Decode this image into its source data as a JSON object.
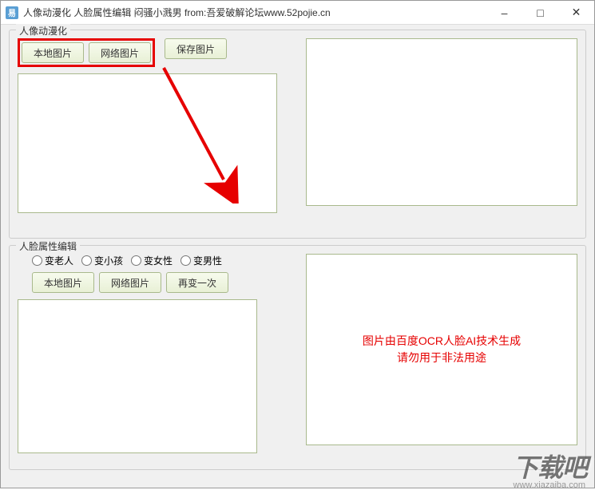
{
  "window": {
    "icon_text": "易",
    "title": "人像动漫化 人脸属性编辑 闷骚小溅男 from:吾爱破解论坛www.52pojie.cn"
  },
  "group1": {
    "title": "人像动漫化",
    "btn_local": "本地图片",
    "btn_net": "网络图片",
    "btn_save": "保存图片"
  },
  "group2": {
    "title": "人脸属性编辑",
    "radio1": "变老人",
    "radio2": "变小孩",
    "radio3": "变女性",
    "radio4": "变男性",
    "btn_local": "本地图片",
    "btn_net": "网络图片",
    "btn_again": "再变一次",
    "notice_line1": "图片由百度OCR人脸AI技术生成",
    "notice_line2": "请勿用于非法用途"
  },
  "watermark": {
    "main": "下载吧",
    "sub": "www.xiazaiba.com"
  }
}
